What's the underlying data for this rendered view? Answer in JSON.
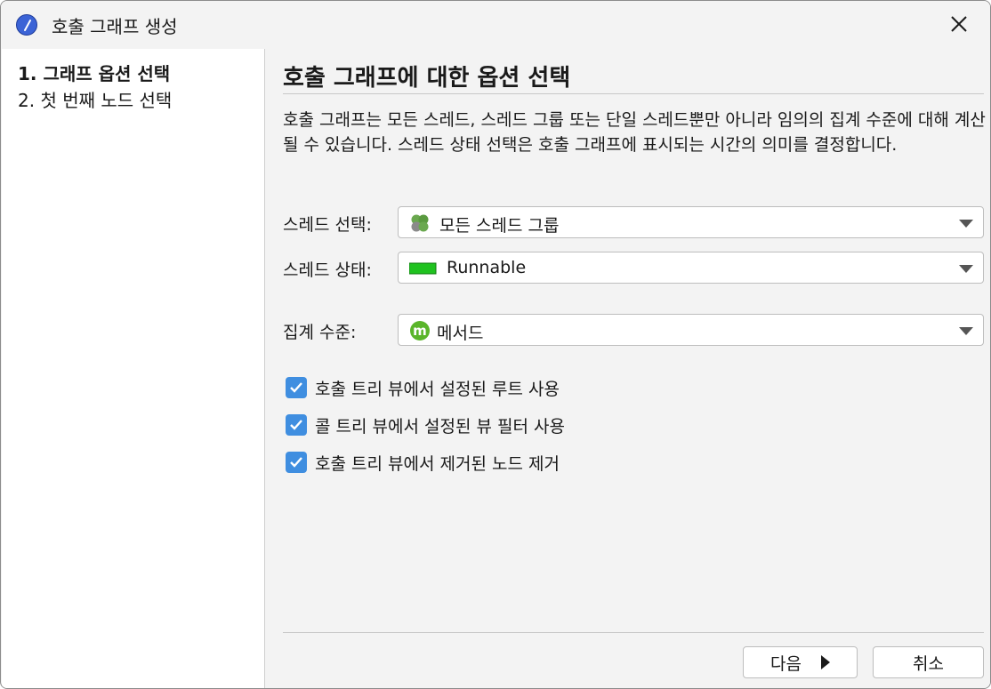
{
  "window": {
    "title": "호출 그래프 생성",
    "app_icon": "compass-icon",
    "close_icon": "close-icon"
  },
  "sidebar": {
    "steps": [
      {
        "label": "1. 그래프 옵션 선택",
        "active": true
      },
      {
        "label": "2. 첫 번째 노드 선택",
        "active": false
      }
    ]
  },
  "main": {
    "heading": "호출 그래프에 대한 옵션 선택",
    "description": "호출 그래프는 모든 스레드, 스레드 그룹 또는 단일 스레드뿐만 아니라 임의의 집계 수준에 대해 계산될 수 있습니다. 스레드 상태 선택은 호출 그래프에 표시되는 시간의 의미를 결정합니다.",
    "fields": {
      "thread_select": {
        "label": "스레드 선택:",
        "value": "모든 스레드 그룹",
        "icon": "thread-group-icon"
      },
      "thread_state": {
        "label": "스레드 상태:",
        "value": "Runnable",
        "icon": "runnable-state-icon",
        "color": "#1fc21f"
      },
      "aggregation": {
        "label": "집계 수준:",
        "value": "메서드",
        "icon": "method-icon",
        "color": "#5ab52a"
      }
    },
    "checkboxes": [
      {
        "label": "호출 트리 뷰에서 설정된 루트 사용",
        "checked": true
      },
      {
        "label": "콜 트리 뷰에서 설정된 뷰 필터 사용",
        "checked": true
      },
      {
        "label": "호출 트리 뷰에서 제거된 노드 제거",
        "checked": true
      }
    ]
  },
  "footer": {
    "next_label": "다음",
    "cancel_label": "취소"
  },
  "colors": {
    "accent": "#3f8ee0",
    "background": "#f3f3f3"
  }
}
